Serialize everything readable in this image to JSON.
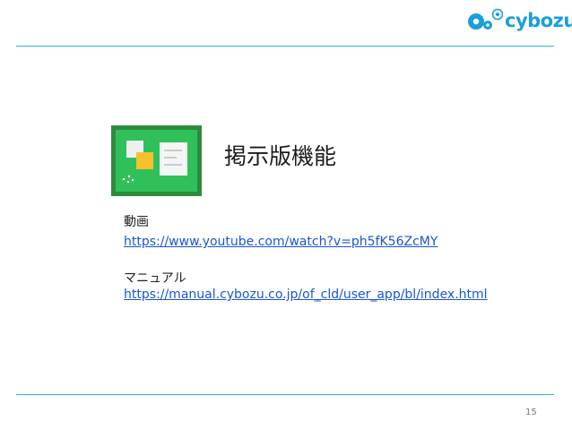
{
  "logo": {
    "text": "cybozu",
    "color": "#1aa0d8"
  },
  "title": "掲示版機能",
  "icon": "bulletin-board-icon",
  "sections": [
    {
      "label": "動画",
      "link": "https://www.youtube.com/watch?v=ph5fK56ZcMY"
    },
    {
      "label": "マニュアル",
      "link": "https://manual.cybozu.co.jp/of_cld/user_app/bl/index.html"
    }
  ],
  "page_number": "15",
  "colors": {
    "rule": "#2eb6e6",
    "link": "#1a56d6",
    "board_frame": "#2e8b3c",
    "board_fill": "#30c05a",
    "note_yellow": "#f6c12b"
  }
}
